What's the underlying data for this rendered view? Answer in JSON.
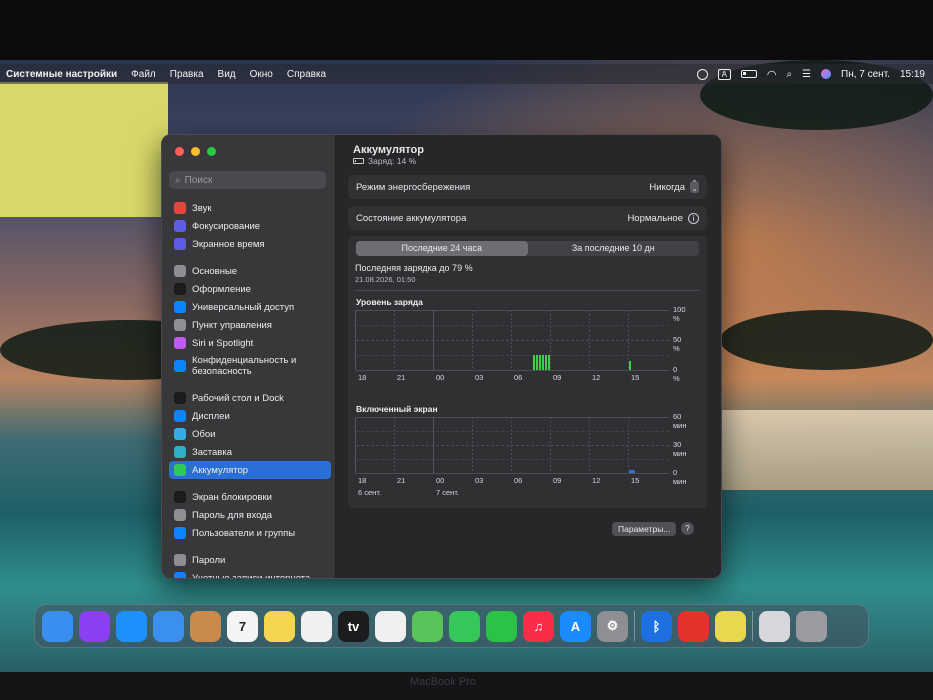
{
  "menubar": {
    "app": "Системные настройки",
    "items": [
      "Файл",
      "Правка",
      "Вид",
      "Окно",
      "Справка"
    ],
    "input_badge": "A",
    "date": "Пн, 7 сент.",
    "time": "15:19"
  },
  "sidebar": {
    "search_placeholder": "Поиск",
    "items": [
      {
        "label": "Звук",
        "icon": "speaker-icon",
        "color": "#e2453c"
      },
      {
        "label": "Фокусирование",
        "icon": "moon-icon",
        "color": "#5e5ce6"
      },
      {
        "label": "Экранное время",
        "icon": "hourglass-icon",
        "color": "#5e5ce6"
      },
      {
        "label": "Основные",
        "icon": "gear-icon",
        "color": "#8e8e93"
      },
      {
        "label": "Оформление",
        "icon": "appearance-icon",
        "color": "#1c1c1e"
      },
      {
        "label": "Универсальный доступ",
        "icon": "accessibility-icon",
        "color": "#0a84ff"
      },
      {
        "label": "Пункт управления",
        "icon": "control-center-icon",
        "color": "#8e8e93"
      },
      {
        "label": "Siri и Spotlight",
        "icon": "siri-icon",
        "color": "#bf5af2"
      },
      {
        "label": "Конфиденциальность и безопасность",
        "icon": "hand-icon",
        "color": "#0a84ff"
      },
      {
        "label": "Рабочий стол и Dock",
        "icon": "desktop-icon",
        "color": "#1c1c1e"
      },
      {
        "label": "Дисплеи",
        "icon": "display-icon",
        "color": "#0a84ff"
      },
      {
        "label": "Обои",
        "icon": "wallpaper-icon",
        "color": "#32ade6"
      },
      {
        "label": "Заставка",
        "icon": "screensaver-icon",
        "color": "#30b0c7"
      },
      {
        "label": "Аккумулятор",
        "icon": "battery-icon",
        "color": "#34c759"
      },
      {
        "label": "Экран блокировки",
        "icon": "lock-icon",
        "color": "#1c1c1e"
      },
      {
        "label": "Пароль для входа",
        "icon": "password-icon",
        "color": "#8e8e93"
      },
      {
        "label": "Пользователи и группы",
        "icon": "users-icon",
        "color": "#0a84ff"
      },
      {
        "label": "Пароли",
        "icon": "key-icon",
        "color": "#8e8e93"
      },
      {
        "label": "Учетные записи интернета",
        "icon": "at-icon",
        "color": "#0a84ff"
      }
    ],
    "active_index": 13
  },
  "main": {
    "title": "Аккумулятор",
    "charge_status": "Заряд: 14 %",
    "low_power": {
      "label": "Режим энергосбережения",
      "value": "Никогда"
    },
    "health": {
      "label": "Состояние аккумулятора",
      "value": "Нормальное"
    },
    "tabs": [
      "Последние 24 часа",
      "За последние 10 дн"
    ],
    "selected_tab": 0,
    "last_charge": "Последняя зарядка до 79 %",
    "last_charge_date": "21.08.2026, 01:50",
    "params_button": "Параметры...",
    "help_button": "?"
  },
  "chart_data": [
    {
      "type": "bar",
      "title": "Уровень заряда",
      "x": [
        "18",
        "21",
        "00",
        "03",
        "06",
        "09",
        "12",
        "15"
      ],
      "y_ticks": [
        "100 %",
        "50 %",
        "0 %"
      ],
      "ylim": [
        0,
        100
      ],
      "series": [
        {
          "values": [
            0,
            0,
            0,
            0,
            0,
            25,
            0,
            15
          ],
          "color": "#3ed04a"
        }
      ]
    },
    {
      "type": "bar",
      "title": "Включенный экран",
      "x": [
        "18",
        "21",
        "00",
        "03",
        "06",
        "09",
        "12",
        "15"
      ],
      "x_dates": [
        "6 сент.",
        "7 сент."
      ],
      "y_ticks": [
        "60 мин",
        "30 мин",
        "0 мин"
      ],
      "ylim": [
        0,
        60
      ],
      "series": [
        {
          "values": [
            0,
            0,
            0,
            0,
            0,
            0,
            0,
            3
          ],
          "color": "#2a7be0"
        }
      ]
    }
  ],
  "dock": [
    {
      "name": "finder-icon",
      "color": "#3a8ef0",
      "glyph": ""
    },
    {
      "name": "siri-icon",
      "color": "#8a3ff0",
      "glyph": ""
    },
    {
      "name": "safari-icon",
      "color": "#1e90ff",
      "glyph": ""
    },
    {
      "name": "mail-icon",
      "color": "#3b8fef",
      "glyph": ""
    },
    {
      "name": "contacts-icon",
      "color": "#c98a4b",
      "glyph": ""
    },
    {
      "name": "calendar-icon",
      "color": "#f4f4f4",
      "glyph": "7"
    },
    {
      "name": "notes-icon",
      "color": "#f5d650",
      "glyph": ""
    },
    {
      "name": "freeform-icon",
      "color": "#f0f0f0",
      "glyph": ""
    },
    {
      "name": "appletv-icon",
      "color": "#1c1c1e",
      "glyph": "tv"
    },
    {
      "name": "reminders-icon",
      "color": "#f0f0f0",
      "glyph": ""
    },
    {
      "name": "maps-icon",
      "color": "#5ac35a",
      "glyph": ""
    },
    {
      "name": "messages-icon",
      "color": "#35c759",
      "glyph": ""
    },
    {
      "name": "facetime-icon",
      "color": "#2bc245",
      "glyph": ""
    },
    {
      "name": "music-icon",
      "color": "#fa2d48",
      "glyph": "♫"
    },
    {
      "name": "appstore-icon",
      "color": "#1a8cff",
      "glyph": "A"
    },
    {
      "name": "system-settings-icon",
      "color": "#8e8e93",
      "glyph": "⚙"
    },
    {
      "name": "bluetooth-icon",
      "color": "#1e6fe0",
      "glyph": "ᛒ"
    },
    {
      "name": "app-red-icon",
      "color": "#e5322c",
      "glyph": ""
    },
    {
      "name": "stickies-icon",
      "color": "#e8d84c",
      "glyph": ""
    },
    {
      "name": "downloads-icon",
      "color": "#d8d8dc",
      "glyph": ""
    },
    {
      "name": "trash-icon",
      "color": "#9a9aa0",
      "glyph": ""
    }
  ],
  "bezel_label": "MacBook Pro"
}
